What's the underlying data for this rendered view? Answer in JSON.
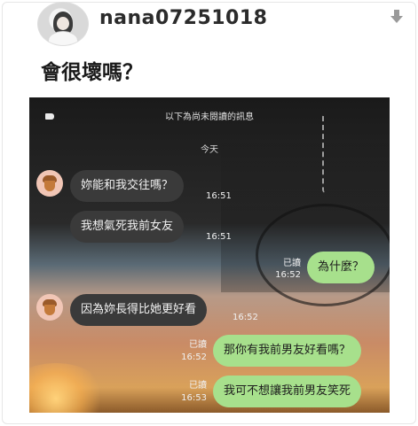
{
  "post": {
    "username": "nana07251018",
    "title": "會很壞嗎？"
  },
  "chat": {
    "unread_label": "以下為尚未閱讀的訊息",
    "date_label": "今天",
    "messages": [
      {
        "side": "in",
        "text": "妳能和我交往嗎？",
        "time": "16:51",
        "read": ""
      },
      {
        "side": "in",
        "text": "我想氣死我前女友",
        "time": "16:51",
        "read": ""
      },
      {
        "side": "out",
        "text": "為什麼？",
        "time": "16:52",
        "read": "已讀"
      },
      {
        "side": "in",
        "text": "因為妳長得比她更好看",
        "time": "16:52",
        "read": ""
      },
      {
        "side": "out",
        "text": "那你有我前男友好看嗎？",
        "time": "16:52",
        "read": "已讀"
      },
      {
        "side": "out",
        "text": "我可不想讓我前男友笑死",
        "time": "16:53",
        "read": "已讀"
      }
    ]
  },
  "colors": {
    "incoming_bubble": "#3a3a3a",
    "outgoing_bubble": "#a7e08c"
  },
  "icons": {
    "download": "download-arrow-icon",
    "chat_back": "tag-back-icon",
    "contact_avatar": "acorn-avatar-icon"
  }
}
